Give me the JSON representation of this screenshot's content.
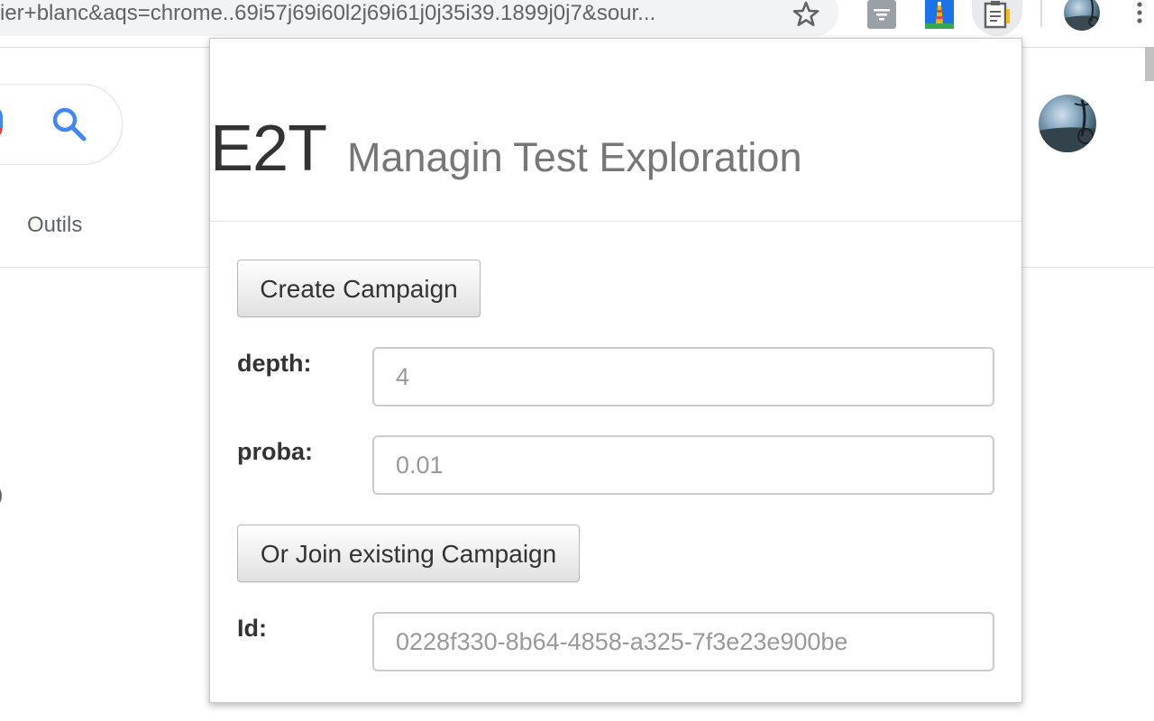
{
  "browser": {
    "url": "ier+blanc&aqs=chrome..69i57j69i60l2j69i61j0j35i39.1899j0j7&sour...",
    "icons": [
      "star-icon",
      "filter-extension-icon",
      "lighthouse-extension-icon",
      "e2t-extension-icon",
      "profile-avatar",
      "menu-icon"
    ]
  },
  "background_page": {
    "tools_label": "Outils",
    "stray_text": ")",
    "icons": [
      "mic-icon",
      "search-icon",
      "profile-avatar"
    ]
  },
  "popup": {
    "brand": "E2T",
    "tagline": "Managin Test Exploration",
    "create_button": "Create Campaign",
    "depth_label": "depth:",
    "depth_placeholder": "4",
    "proba_label": "proba:",
    "proba_placeholder": "0.01",
    "join_button": "Or Join existing Campaign",
    "id_label": "Id:",
    "id_placeholder": "0228f330-8b64-4858-a325-7f3e23e900be"
  },
  "colors": {
    "google_blue": "#4285f4",
    "label_text": "#333333",
    "placeholder_text": "#999999",
    "tagline_text": "#777777"
  }
}
